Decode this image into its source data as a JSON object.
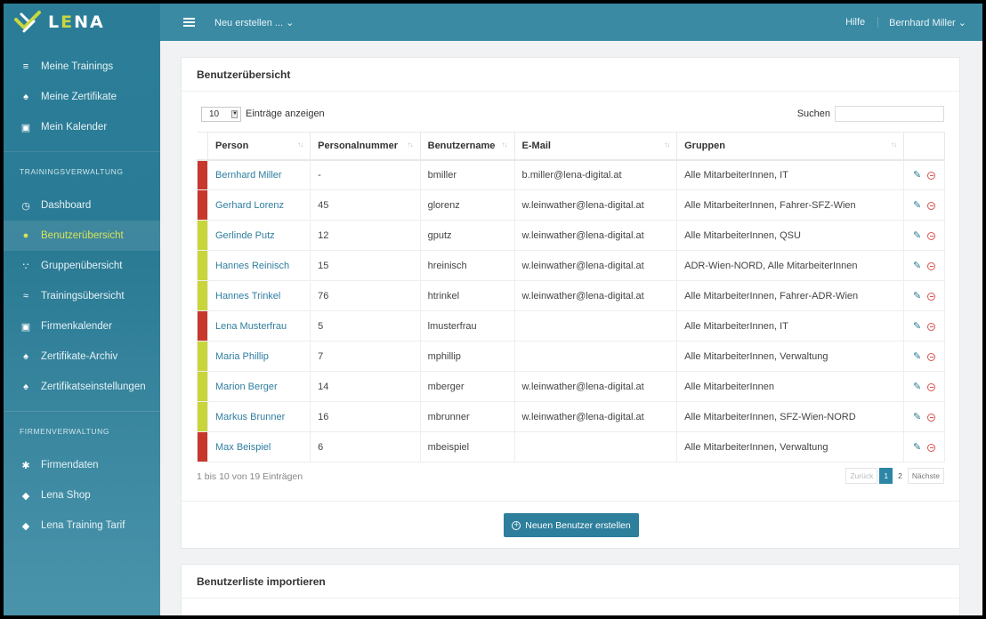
{
  "brand": {
    "name_prefix": "L",
    "name_accent": "E",
    "name_suffix": "NA"
  },
  "topbar": {
    "create": "Neu erstellen ... ⌄",
    "help": "Hilfe",
    "user": "Bernhard Miller ⌄"
  },
  "sidebar": {
    "items_top": [
      {
        "icon": "list-icon",
        "glyph": "≡",
        "label": "Meine Trainings"
      },
      {
        "icon": "certificate-icon",
        "glyph": "♠",
        "label": "Meine Zertifikate"
      },
      {
        "icon": "calendar-icon",
        "glyph": "▣",
        "label": "Mein Kalender"
      }
    ],
    "section1": "TRAININGSVERWALTUNG",
    "items_mid": [
      {
        "icon": "dashboard-icon",
        "glyph": "◷",
        "label": "Dashboard"
      },
      {
        "icon": "user-icon",
        "glyph": "●",
        "label": "Benutzerübersicht"
      },
      {
        "icon": "group-icon",
        "glyph": "∵",
        "label": "Gruppenübersicht"
      },
      {
        "icon": "layers-icon",
        "glyph": "≈",
        "label": "Trainingsübersicht"
      },
      {
        "icon": "calendar-icon",
        "glyph": "▣",
        "label": "Firmenkalender"
      },
      {
        "icon": "certificate-icon",
        "glyph": "♠",
        "label": "Zertifikate-Archiv"
      },
      {
        "icon": "certificate-icon",
        "glyph": "♠",
        "label": "Zertifikatseinstellungen"
      }
    ],
    "section2": "FIRMENVERWALTUNG",
    "items_bottom": [
      {
        "icon": "gear-icon",
        "glyph": "✱",
        "label": "Firmendaten"
      },
      {
        "icon": "tag-icon",
        "glyph": "◆",
        "label": "Lena Shop"
      },
      {
        "icon": "tag-icon",
        "glyph": "◆",
        "label": "Lena Training Tarif"
      }
    ],
    "active": "Benutzerübersicht"
  },
  "overview": {
    "title": "Benutzerübersicht",
    "length_value": "10",
    "length_label": "Einträge anzeigen",
    "search_label": "Suchen",
    "columns": [
      "Person",
      "Personalnummer",
      "Benutzername",
      "E-Mail",
      "Gruppen"
    ],
    "rows": [
      {
        "status": "red",
        "person": "Bernhard Miller",
        "nr": "-",
        "user": "bmiller",
        "email": "b.miller@lena-digital.at",
        "groups": "Alle MitarbeiterInnen, IT"
      },
      {
        "status": "red",
        "person": "Gerhard Lorenz",
        "nr": "45",
        "user": "glorenz",
        "email": "w.leinwather@lena-digital.at",
        "groups": "Alle MitarbeiterInnen, Fahrer-SFZ-Wien"
      },
      {
        "status": "yellow",
        "person": "Gerlinde Putz",
        "nr": "12",
        "user": "gputz",
        "email": "w.leinwather@lena-digital.at",
        "groups": "Alle MitarbeiterInnen, QSU"
      },
      {
        "status": "yellow",
        "person": "Hannes Reinisch",
        "nr": "15",
        "user": "hreinisch",
        "email": "w.leinwather@lena-digital.at",
        "groups": "ADR-Wien-NORD, Alle MitarbeiterInnen"
      },
      {
        "status": "yellow",
        "person": "Hannes Trinkel",
        "nr": "76",
        "user": "htrinkel",
        "email": "w.leinwather@lena-digital.at",
        "groups": "Alle MitarbeiterInnen, Fahrer-ADR-Wien"
      },
      {
        "status": "red",
        "person": "Lena Musterfrau",
        "nr": "5",
        "user": "lmusterfrau",
        "email": "",
        "groups": "Alle MitarbeiterInnen, IT"
      },
      {
        "status": "yellow",
        "person": "Maria Phillip",
        "nr": "7",
        "user": "mphillip",
        "email": "",
        "groups": "Alle MitarbeiterInnen, Verwaltung"
      },
      {
        "status": "yellow",
        "person": "Marion Berger",
        "nr": "14",
        "user": "mberger",
        "email": "w.leinwather@lena-digital.at",
        "groups": "Alle MitarbeiterInnen"
      },
      {
        "status": "yellow",
        "person": "Markus Brunner",
        "nr": "16",
        "user": "mbrunner",
        "email": "w.leinwather@lena-digital.at",
        "groups": "Alle MitarbeiterInnen, SFZ-Wien-NORD"
      },
      {
        "status": "red",
        "person": "Max Beispiel",
        "nr": "6",
        "user": "mbeispiel",
        "email": "",
        "groups": "Alle MitarbeiterInnen, Verwaltung"
      }
    ],
    "info": "1 bis 10 von 19 Einträgen",
    "pager": {
      "prev": "Zurück",
      "pages": [
        "1",
        "2"
      ],
      "current": "1",
      "next": "Nächste"
    },
    "new_button": "Neuen Benutzer erstellen"
  },
  "import": {
    "title": "Benutzerliste importieren"
  },
  "colors": {
    "red": "#c8372d",
    "yellow": "#c9d53a",
    "accent": "#2d7f9c",
    "link": "#2f7ea0"
  }
}
